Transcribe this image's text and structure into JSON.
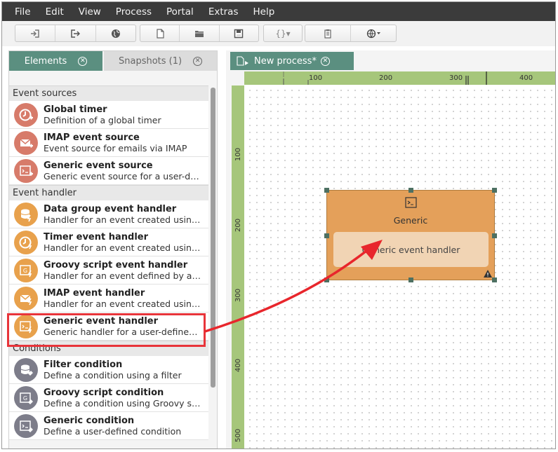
{
  "menubar": {
    "items": [
      {
        "label": "File"
      },
      {
        "label": "Edit"
      },
      {
        "label": "View"
      },
      {
        "label": "Process"
      },
      {
        "label": "Portal"
      },
      {
        "label": "Extras"
      },
      {
        "label": "Help"
      }
    ]
  },
  "toolbar": {
    "icons": [
      "import-icon",
      "export-icon",
      "globe-icon",
      "new-file-icon",
      "open-folder-icon",
      "save-icon",
      "braces-dropdown-icon",
      "document-icon",
      "language-dropdown-icon"
    ]
  },
  "left_panel": {
    "tabs": [
      {
        "label": "Elements",
        "active": true
      },
      {
        "label": "Snapshots (1)",
        "active": false
      }
    ],
    "sections": [
      {
        "title": "Event sources",
        "items": [
          {
            "title": "Global timer",
            "desc": "Definition of a global timer",
            "icon": "timer-icon"
          },
          {
            "title": "IMAP event source",
            "desc": "Event source for emails via IMAP",
            "icon": "mail-icon"
          },
          {
            "title": "Generic event source",
            "desc": "Generic event source for a user-defi...",
            "icon": "script-icon"
          }
        ]
      },
      {
        "title": "Event handler",
        "items": [
          {
            "title": "Data group event handler",
            "desc": "Handler for an event created using ...",
            "icon": "database-icon"
          },
          {
            "title": "Timer event handler",
            "desc": "Handler for an event created using ...",
            "icon": "timer-icon"
          },
          {
            "title": "Groovy script event handler",
            "desc": "Handler for an event defined by a G...",
            "icon": "groovy-icon"
          },
          {
            "title": "IMAP event handler",
            "desc": "Handler for an event created using ...",
            "icon": "mail-icon"
          },
          {
            "title": "Generic event handler",
            "desc": "Generic handler for a user-defined e...",
            "icon": "script-icon"
          }
        ]
      },
      {
        "title": "Conditions",
        "items": [
          {
            "title": "Filter condition",
            "desc": "Define a condition using a filter",
            "icon": "filter-icon"
          },
          {
            "title": "Groovy script condition",
            "desc": "Define a condition using Groovy scri...",
            "icon": "groovy-icon"
          },
          {
            "title": "Generic condition",
            "desc": "Define a user-defined condition",
            "icon": "script-icon"
          }
        ]
      }
    ]
  },
  "editor": {
    "tab_label": "New process*",
    "ruler_top": [
      "100",
      "200",
      "300",
      "400"
    ],
    "ruler_left": [
      "100",
      "200",
      "300",
      "400",
      "500"
    ],
    "node": {
      "label": "Generic",
      "inner_label": "Generic event handler"
    }
  },
  "colors": {
    "menubar": "#3b3b3b",
    "tab_active": "#5b8f80",
    "ruler": "#a6c67b",
    "node": "#e4a05a",
    "node_inner": "#f1d4b4",
    "highlight": "#e8343a"
  }
}
